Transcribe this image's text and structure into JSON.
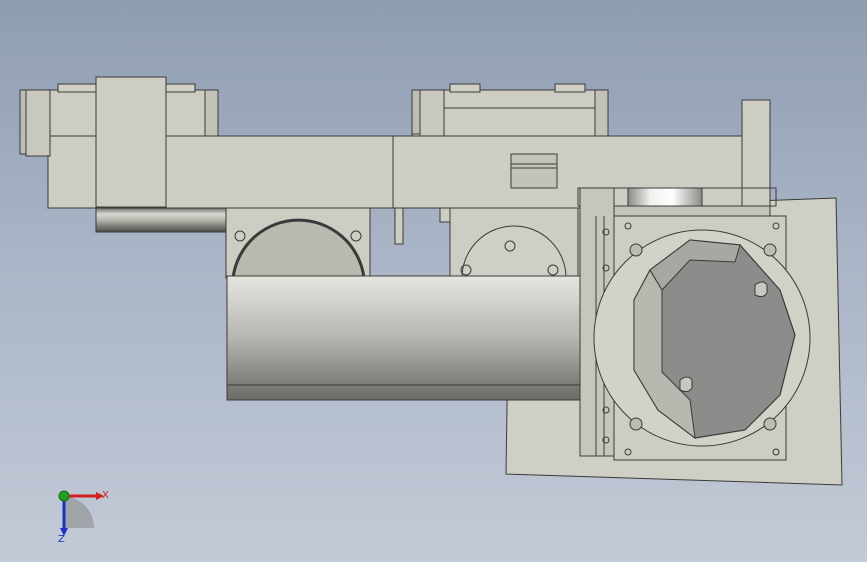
{
  "view": {
    "type": "cad-3d-viewport"
  },
  "colors": {
    "background_top": "#8f9db2",
    "background_bottom": "#c3cad7",
    "part_face": "#c9c9bf",
    "part_face_light": "#d6d6cd",
    "part_face_dark": "#a9a99f",
    "edge": "#3a3a3a",
    "motor_gray": "#8a8a8a",
    "axis_x": "#d42020",
    "axis_y": "#20a020",
    "axis_z": "#2030c0"
  },
  "triad": {
    "x_label": "X",
    "y_label": "",
    "z_label": "Z"
  }
}
